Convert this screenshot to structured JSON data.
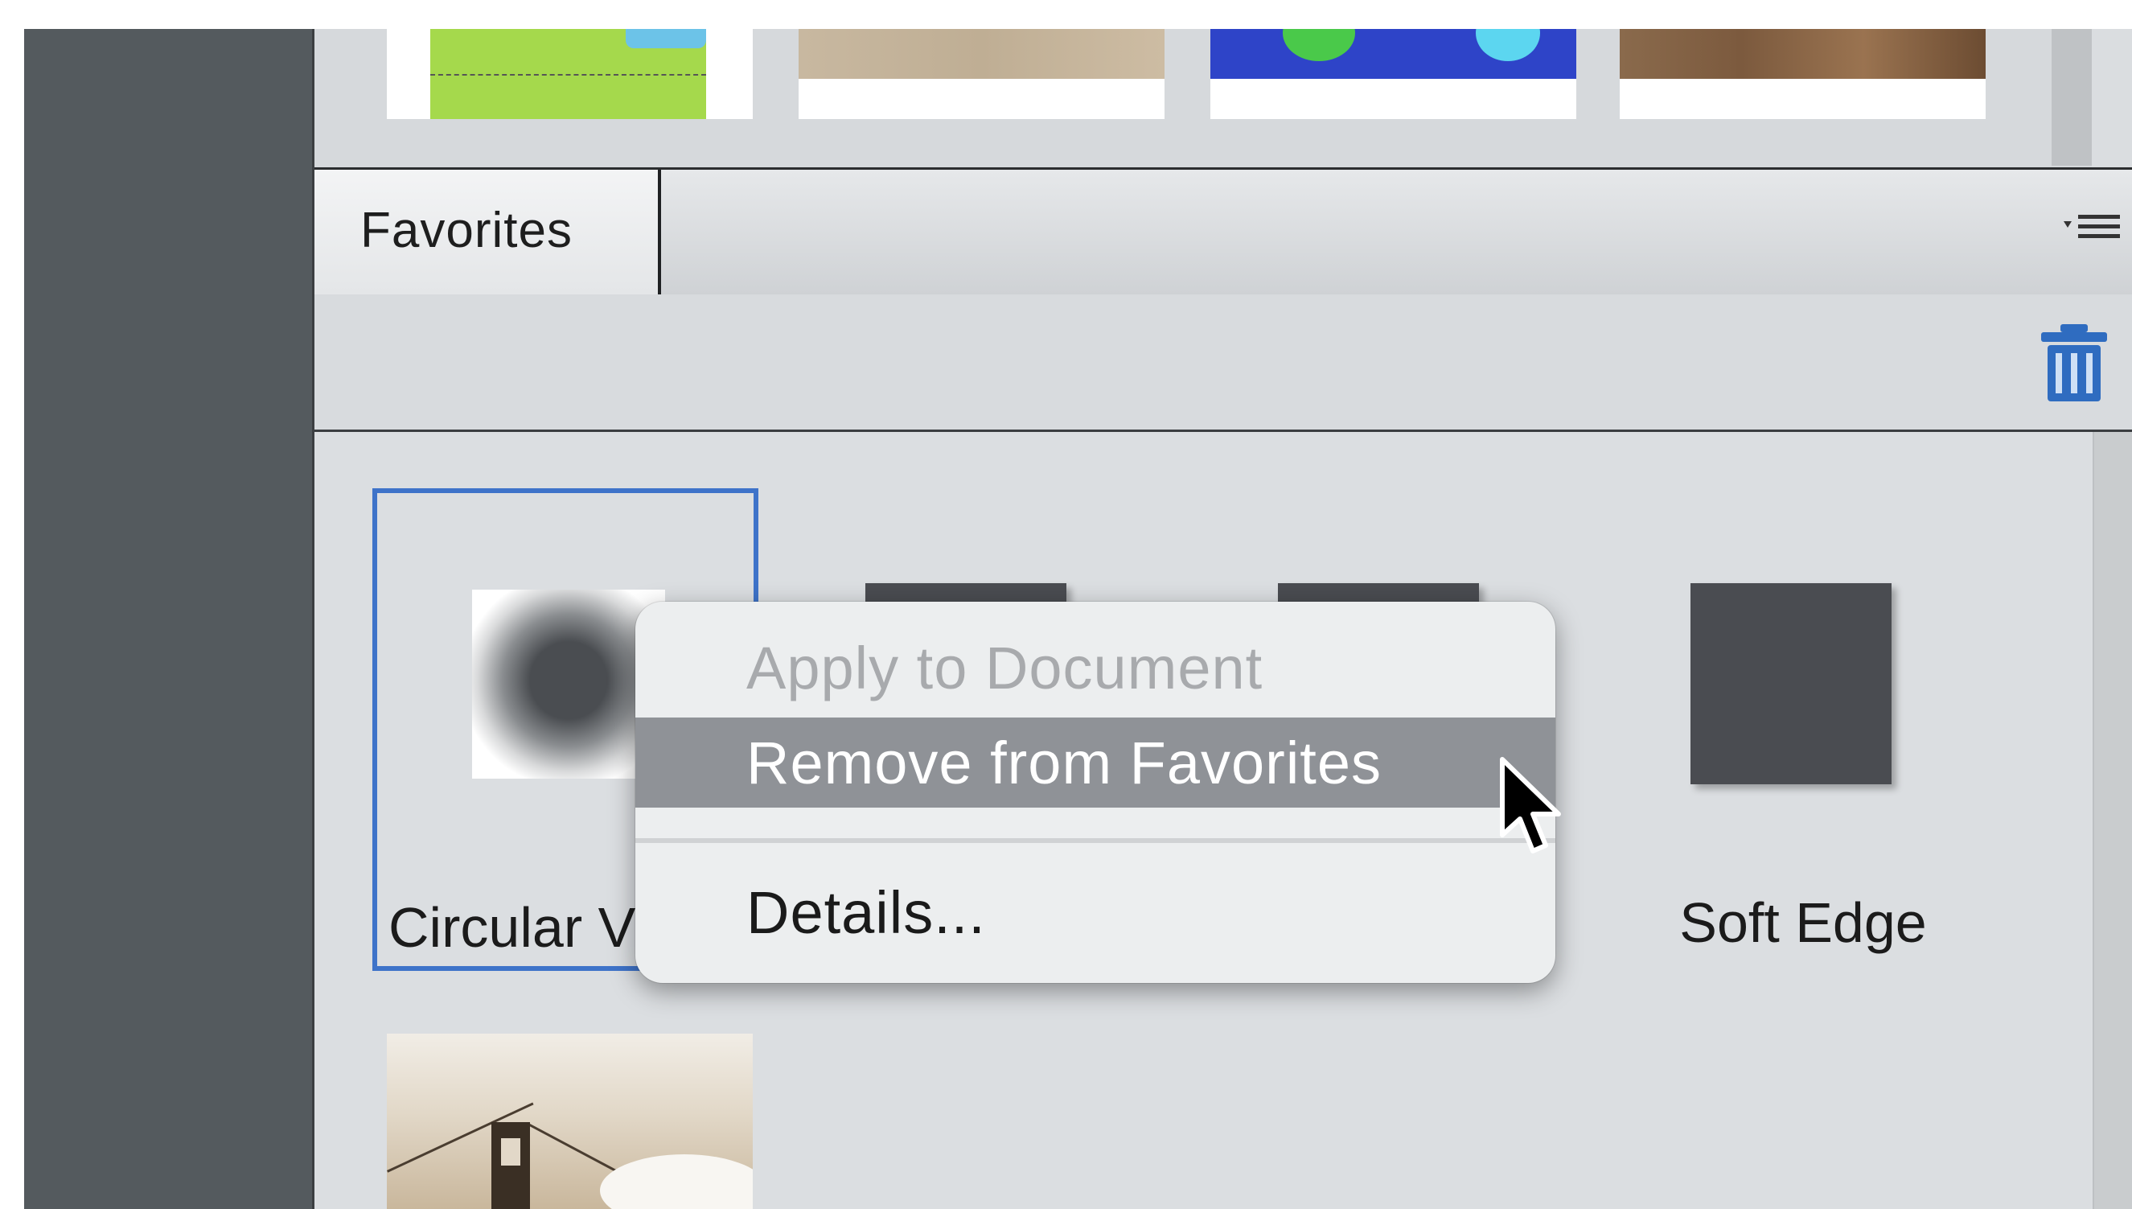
{
  "top_strip": {
    "thumbnails": [
      {
        "name": "effect-thumbnail-green"
      },
      {
        "name": "effect-thumbnail-sepia"
      },
      {
        "name": "effect-thumbnail-blue"
      },
      {
        "name": "effect-thumbnail-brown"
      }
    ]
  },
  "panel": {
    "tab_label": "Favorites",
    "menu_icon": "panel-menu-icon",
    "trash_icon": "trash-icon"
  },
  "favorites": {
    "items": [
      {
        "label": "Circular V",
        "selected": true,
        "kind": "blurred-circle"
      },
      {
        "label": "",
        "kind": "dark-square"
      },
      {
        "label": "",
        "kind": "dark-square"
      },
      {
        "label": "Soft Edge",
        "kind": "dark-square"
      }
    ]
  },
  "context_menu": {
    "items": [
      {
        "label": "Apply to Document",
        "enabled": false
      },
      {
        "label": "Remove from Favorites",
        "enabled": true,
        "highlighted": true
      },
      {
        "label": "Details...",
        "enabled": true
      }
    ]
  },
  "colors": {
    "selection_border": "#3e73c9",
    "menu_highlight": "#8f9297",
    "dark_sidebar": "#545a5e",
    "trash_blue": "#2f6cc0"
  }
}
